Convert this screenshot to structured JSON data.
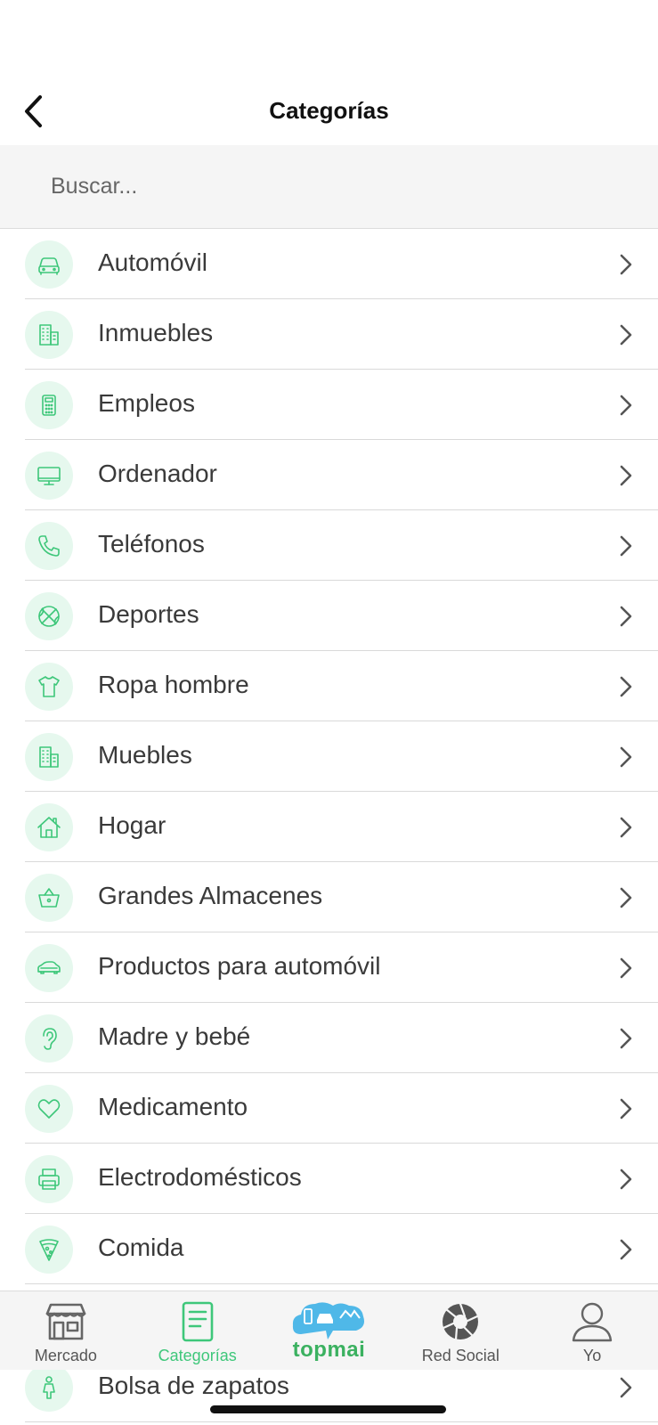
{
  "header": {
    "title": "Categorías"
  },
  "search": {
    "placeholder": "Buscar..."
  },
  "categories": [
    {
      "label": "Automóvil",
      "icon": "car-icon"
    },
    {
      "label": "Inmuebles",
      "icon": "building-icon"
    },
    {
      "label": "Empleos",
      "icon": "calculator-icon"
    },
    {
      "label": "Ordenador",
      "icon": "monitor-icon"
    },
    {
      "label": "Teléfonos",
      "icon": "phone-icon"
    },
    {
      "label": "Deportes",
      "icon": "basketball-icon"
    },
    {
      "label": "Ropa hombre",
      "icon": "tshirt-icon"
    },
    {
      "label": "Muebles",
      "icon": "building-icon"
    },
    {
      "label": "Hogar",
      "icon": "house-icon"
    },
    {
      "label": "Grandes Almacenes",
      "icon": "basket-icon"
    },
    {
      "label": "Productos para automóvil",
      "icon": "car-side-icon"
    },
    {
      "label": "Madre y bebé",
      "icon": "ear-icon"
    },
    {
      "label": "Medicamento",
      "icon": "heart-icon"
    },
    {
      "label": "Electrodomésticos",
      "icon": "printer-icon"
    },
    {
      "label": "Comida",
      "icon": "pizza-icon"
    },
    {
      "label": "Bolsa de zapatos",
      "icon": "person-icon"
    }
  ],
  "tabbar": {
    "tabs": [
      {
        "label": "Mercado",
        "icon": "store-icon",
        "active": false
      },
      {
        "label": "Categorías",
        "icon": "document-icon",
        "active": true
      },
      {
        "label": "topmai",
        "icon": "topmai-logo",
        "active": false
      },
      {
        "label": "Red Social",
        "icon": "aperture-icon",
        "active": false
      },
      {
        "label": "Yo",
        "icon": "user-icon",
        "active": false
      }
    ]
  },
  "colors": {
    "accent": "#3ec77a",
    "icon_bg": "#e6f8ee",
    "brand": "#3bb160",
    "brand_bubble": "#4fb8e8"
  }
}
